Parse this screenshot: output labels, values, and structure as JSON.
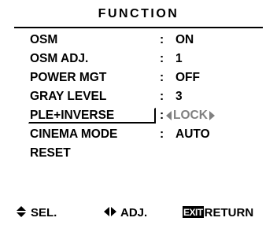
{
  "menu": {
    "title": "FUNCTION",
    "items": [
      {
        "label": "OSM",
        "colon": ":",
        "value": "ON"
      },
      {
        "label": "OSM ADJ.",
        "colon": ":",
        "value": "1"
      },
      {
        "label": "POWER MGT",
        "colon": ":",
        "value": "OFF"
      },
      {
        "label": "GRAY LEVEL",
        "colon": ":",
        "value": "3"
      },
      {
        "label": "PLE+INVERSE",
        "colon": ":",
        "value": "LOCK"
      },
      {
        "label": "CINEMA MODE",
        "colon": ":",
        "value": "AUTO"
      },
      {
        "label": "RESET",
        "colon": "",
        "value": ""
      }
    ],
    "selected_index": 4
  },
  "footer": {
    "sel_label": "SEL.",
    "adj_label": "ADJ.",
    "exit_badge": "EXIT",
    "return_label": "RETURN"
  }
}
